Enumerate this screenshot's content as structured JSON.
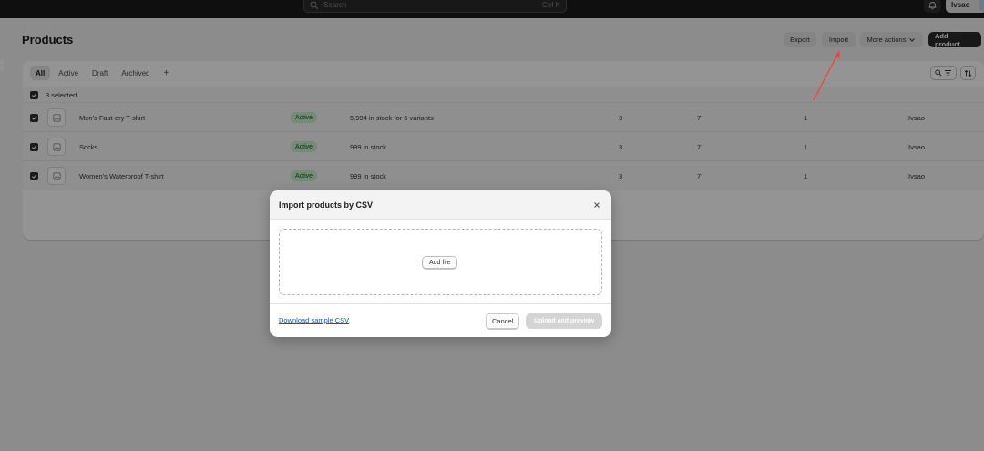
{
  "topbar": {
    "search_placeholder": "Search",
    "search_shortcut": "Ctrl K",
    "user_name": "Ivsao"
  },
  "page": {
    "title": "Products",
    "export_label": "Export",
    "import_label": "Import",
    "more_actions_label": "More actions",
    "add_product_label": "Add product"
  },
  "tabs": [
    "All",
    "Active",
    "Draft",
    "Archived",
    "+"
  ],
  "selection": {
    "label": "3 selected"
  },
  "products": [
    {
      "name": "Men's Fast-dry T-shirt",
      "status": "Active",
      "inventory": "5,994 in stock for 6 variants",
      "col_a": "3",
      "col_b": "7",
      "col_c": "1",
      "vendor": "Ivsao"
    },
    {
      "name": "Socks",
      "status": "Active",
      "inventory": "999 in stock",
      "col_a": "3",
      "col_b": "7",
      "col_c": "1",
      "vendor": "Ivsao"
    },
    {
      "name": "Women's Waterproof T-shirt",
      "status": "Active",
      "inventory": "999 in stock",
      "col_a": "3",
      "col_b": "7",
      "col_c": "1",
      "vendor": "Ivsao"
    }
  ],
  "modal": {
    "title": "Import products by CSV",
    "add_file_label": "Add file",
    "download_link": "Download sample CSV",
    "cancel_label": "Cancel",
    "upload_label": "Upload and preview"
  },
  "colors": {
    "topbar": "#1a1a1a",
    "primary_button": "#2a2a2a",
    "active_badge_bg": "#c8f0c9",
    "active_badge_text": "#0c5132",
    "link": "#005bd3",
    "annotation_arrow": "#ff3b30"
  },
  "icons": [
    "search-icon",
    "bell-icon",
    "chevron-down-icon",
    "filter-icon",
    "sort-icon",
    "checkbox-checked-icon",
    "image-placeholder-icon",
    "close-icon"
  ]
}
